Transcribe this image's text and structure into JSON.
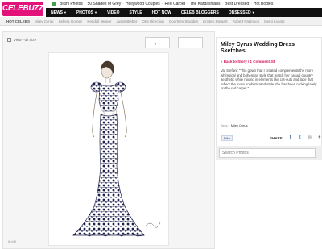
{
  "brand": {
    "logo_text": "CELEBUZZ!"
  },
  "trending": {
    "items": [
      "Bikini Photos",
      "50 Shades of Grey",
      "Hollywood Couples",
      "Red Carpet",
      "The Kardashians",
      "Best Dressed",
      "Hot Bodies"
    ]
  },
  "nav": {
    "items": [
      "NEWS",
      "PHOTOS",
      "VIDEO",
      "STYLE",
      "HOT NOW",
      "CELEB BLOGGERS",
      "OBSESSED"
    ]
  },
  "hot_celebs": {
    "label": "HOT CELEBS",
    "items": [
      "Miley Cyrus",
      "Selena Gomez",
      "Kendall Jenner",
      "Justin Bieber",
      "One Direction",
      "Courtney Stodden",
      "Kristen Stewart",
      "Robert Pattinson",
      "Demi Lovato"
    ]
  },
  "viewer": {
    "view_full_label": "View Full Size",
    "counter": "8 of 8"
  },
  "article": {
    "title": "Miley Cyrus Wedding Dress Sketches",
    "back_link": "« Back to Story",
    "comments_link": "1 Comment",
    "comment_count": "33",
    "caption": "Vai Stefani: \"This gown that I created complements the more whimsical and bohemian style that match her casual country aesthetic while mixing in elements like cut-outs and lace that reflect the more sophisticated style she has been rocking lately on the red carpet.\"",
    "tags_label": "Tags:",
    "tag": "Miley Cyrus"
  },
  "share": {
    "like_label": "Like",
    "share_label": "SHARE:",
    "facebook_glyph": "f",
    "twitter_glyph": "t",
    "email_glyph": "✉",
    "more_glyph": "+"
  },
  "search": {
    "placeholder": "Search Photos"
  },
  "colors": {
    "brand_pink": "#e2127a",
    "link_pink": "#d4145a",
    "nav_black": "#111111"
  }
}
